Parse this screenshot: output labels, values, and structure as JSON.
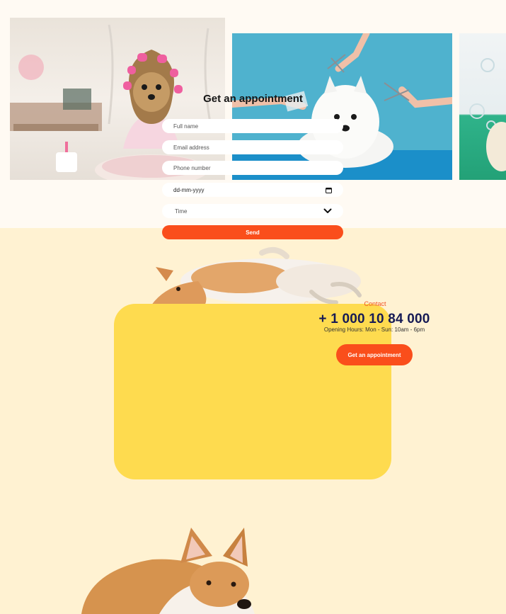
{
  "gallery": {
    "photos": [
      {
        "icon": "yorkie-dog-in-curlers-photo"
      },
      {
        "icon": "westie-dog-grooming-scissors-photo"
      },
      {
        "icon": "dog-bath-bubbles-photo"
      }
    ]
  },
  "appointment": {
    "title": "Get an appointment",
    "fields": {
      "full_name_placeholder": "Full name",
      "email_placeholder": "Email address",
      "phone_placeholder": "Phone number",
      "date_placeholder": "dd-mm-yyyy",
      "time_placeholder": "Time"
    },
    "send_label": "Send",
    "colors": {
      "card": "#fedb4f",
      "button": "#fa4e1b",
      "background": "#fff2d2"
    }
  },
  "contact": {
    "label": "Contact",
    "phone": "+ 1 000 10 84 000",
    "hours": "Opening Hours: Mon - Sun: 10am - 6pm",
    "cta_label": "Get an appointment",
    "colors": {
      "label": "#f05323",
      "phone": "#161a55"
    }
  }
}
